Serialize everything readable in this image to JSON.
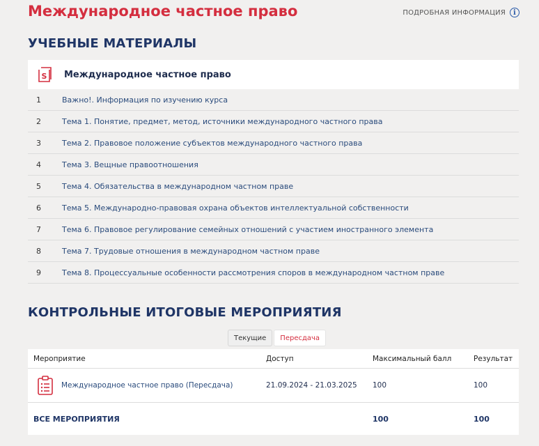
{
  "header": {
    "title": "Международное частное право",
    "more_info_label": "ПОДРОБНАЯ ИНФОРМАЦИЯ",
    "info_icon": "info-icon",
    "accent_color": "#d42e3f"
  },
  "materials": {
    "heading": "УЧЕБНЫЕ МАТЕРИАЛЫ",
    "course_title": "Международное частное право",
    "course_icon": "course-book-icon",
    "items": [
      {
        "num": "1",
        "label": "Важно!. Информация по изучению курса"
      },
      {
        "num": "2",
        "label": "Тема 1. Понятие, предмет, метод, источники международного частного права"
      },
      {
        "num": "3",
        "label": "Тема 2. Правовое положение субъектов международного частного права"
      },
      {
        "num": "4",
        "label": "Тема 3. Вещные правоотношения"
      },
      {
        "num": "5",
        "label": "Тема 4. Обязательства в международном частном праве"
      },
      {
        "num": "6",
        "label": "Тема 5. Международно-правовая охрана объектов интеллектуальной собственности"
      },
      {
        "num": "7",
        "label": "Тема 6. Правовое регулирование семейных отношений с участием иностранного элемента"
      },
      {
        "num": "8",
        "label": "Тема 7. Трудовые отношения в международном частном праве"
      },
      {
        "num": "9",
        "label": "Тема 8. Процессуальные особенности рассмотрения споров в международном частном праве"
      }
    ]
  },
  "events": {
    "heading": "КОНТРОЛЬНЫЕ ИТОГОВЫЕ МЕРОПРИЯТИЯ",
    "tabs": [
      {
        "label": "Текущие",
        "active": false
      },
      {
        "label": "Пересдача",
        "active": true
      }
    ],
    "columns": {
      "event": "Мероприятие",
      "access": "Доступ",
      "max_score": "Максимальный балл",
      "result": "Результат"
    },
    "rows": [
      {
        "name": "Международное частное право (Пересдача)",
        "access": "21.09.2024 - 21.03.2025",
        "max_score": "100",
        "result": "100",
        "icon": "clipboard-task-icon"
      }
    ],
    "total": {
      "label": "ВСЕ МЕРОПРИЯТИЯ",
      "max_score": "100",
      "result": "100"
    }
  }
}
